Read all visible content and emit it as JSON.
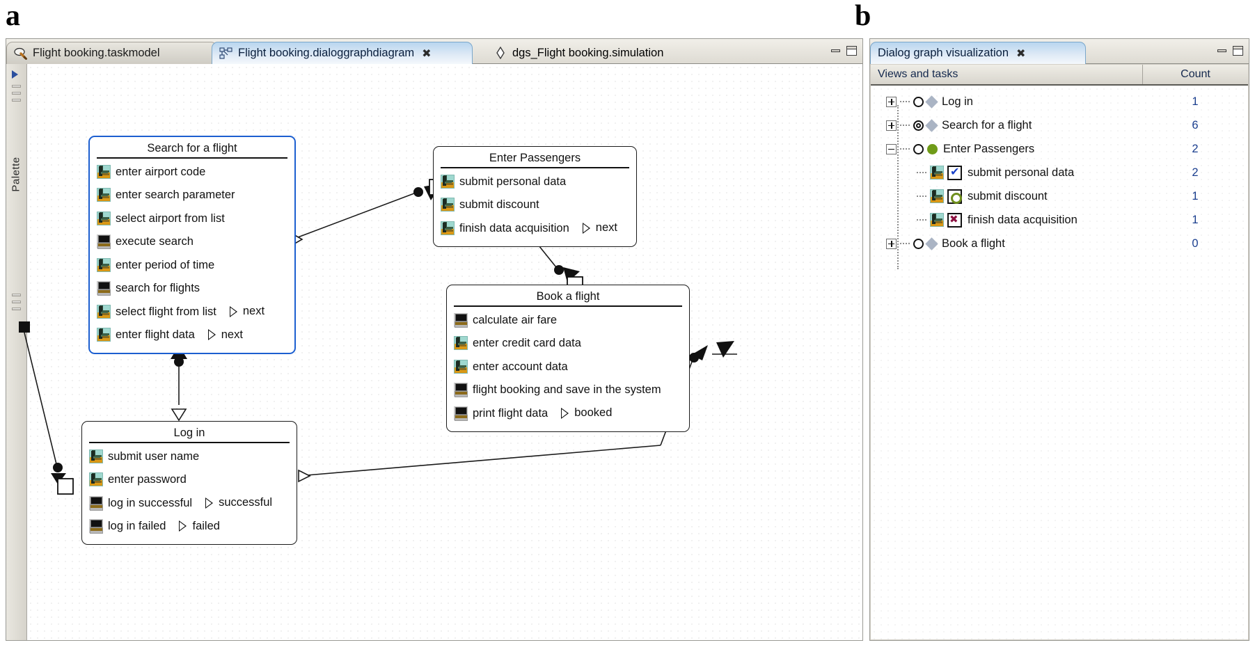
{
  "figure": {
    "label_a": "a",
    "label_b": "b"
  },
  "editor": {
    "tabs": [
      {
        "label": "Flight booking.taskmodel",
        "icon": "taskmodel-icon",
        "active": false,
        "closable": false
      },
      {
        "label": "Flight booking.dialoggraphdiagram",
        "icon": "dialoggraph-icon",
        "active": true,
        "closable": true,
        "close_glyph": "✖"
      },
      {
        "label": "dgs_Flight booking.simulation",
        "icon": "simulation-icon",
        "active": false,
        "closable": false
      }
    ],
    "window_buttons": {
      "minimize": "minimize-icon",
      "maximize": "maximize-icon"
    },
    "palette": {
      "label": "Palette",
      "arrow": "palette-arrow-icon"
    }
  },
  "diagram": {
    "nodes": [
      {
        "id": "search",
        "title": "Search for a flight",
        "selected": true,
        "rows": [
          {
            "icon": "user-task-icon",
            "label": "enter airport code",
            "trigger": ""
          },
          {
            "icon": "user-task-icon",
            "label": "enter search parameter",
            "trigger": ""
          },
          {
            "icon": "user-task-icon",
            "label": "select airport from list",
            "trigger": ""
          },
          {
            "icon": "system-task-icon",
            "label": "execute search",
            "trigger": ""
          },
          {
            "icon": "user-task-icon",
            "label": "enter period of time",
            "trigger": ""
          },
          {
            "icon": "system-task-icon",
            "label": "search for flights",
            "trigger": ""
          },
          {
            "icon": "user-task-icon",
            "label": "select flight from list",
            "trigger": "next"
          },
          {
            "icon": "user-task-icon",
            "label": "enter flight data",
            "trigger": "next"
          }
        ]
      },
      {
        "id": "passengers",
        "title": "Enter Passengers",
        "selected": false,
        "rows": [
          {
            "icon": "user-task-icon",
            "label": "submit personal data",
            "trigger": ""
          },
          {
            "icon": "user-task-icon",
            "label": "submit discount",
            "trigger": ""
          },
          {
            "icon": "user-task-icon",
            "label": "finish data acquisition",
            "trigger": "next"
          }
        ]
      },
      {
        "id": "book",
        "title": "Book a flight",
        "selected": false,
        "rows": [
          {
            "icon": "system-task-icon",
            "label": "calculate air fare",
            "trigger": ""
          },
          {
            "icon": "user-task-icon",
            "label": "enter credit card data",
            "trigger": ""
          },
          {
            "icon": "user-task-icon",
            "label": "enter account data",
            "trigger": ""
          },
          {
            "icon": "system-task-icon",
            "label": "flight booking and save in the system",
            "trigger": ""
          },
          {
            "icon": "system-task-icon",
            "label": "print flight data",
            "trigger": "booked"
          }
        ]
      },
      {
        "id": "login",
        "title": "Log in",
        "selected": false,
        "rows": [
          {
            "icon": "user-task-icon",
            "label": "submit user name",
            "trigger": ""
          },
          {
            "icon": "user-task-icon",
            "label": "enter password",
            "trigger": ""
          },
          {
            "icon": "system-task-icon",
            "label": "log in successful",
            "trigger": "successful"
          },
          {
            "icon": "system-task-icon",
            "label": "log in failed",
            "trigger": "failed"
          }
        ]
      }
    ]
  },
  "visualization": {
    "tab_title": "Dialog graph visualization",
    "tab_close_glyph": "✖",
    "window_buttons": {
      "minimize": "minimize-icon",
      "maximize": "maximize-icon"
    },
    "columns": {
      "name": "Views and tasks",
      "count": "Count"
    },
    "rows": [
      {
        "depth": 0,
        "expander": "plus",
        "state": "circle",
        "marker": "diamond-grey",
        "label": "Log in",
        "count": "1"
      },
      {
        "depth": 0,
        "expander": "plus",
        "state": "double-circle",
        "marker": "diamond-grey",
        "label": "Search for a flight",
        "count": "6"
      },
      {
        "depth": 0,
        "expander": "minus",
        "state": "circle",
        "marker": "circle-green",
        "label": "Enter Passengers",
        "count": "2"
      },
      {
        "depth": 1,
        "expander": "none",
        "state": "checkbox-check",
        "marker": "user-task-icon",
        "label": "submit personal data",
        "count": "2"
      },
      {
        "depth": 1,
        "expander": "none",
        "state": "checkbox-ring",
        "marker": "user-task-icon",
        "label": "submit discount",
        "count": "1"
      },
      {
        "depth": 1,
        "expander": "none",
        "state": "checkbox-cross",
        "marker": "user-task-icon",
        "label": "finish data acquisition",
        "count": "1"
      },
      {
        "depth": 0,
        "expander": "plus",
        "state": "circle",
        "marker": "diamond-grey",
        "label": "Book a flight",
        "count": "0"
      }
    ]
  },
  "colors": {
    "accent_blue": "#1c5fd0",
    "chrome": "#d4d0c8",
    "count_text": "#1b3f8f",
    "tab_active": "#b9d6ef"
  }
}
